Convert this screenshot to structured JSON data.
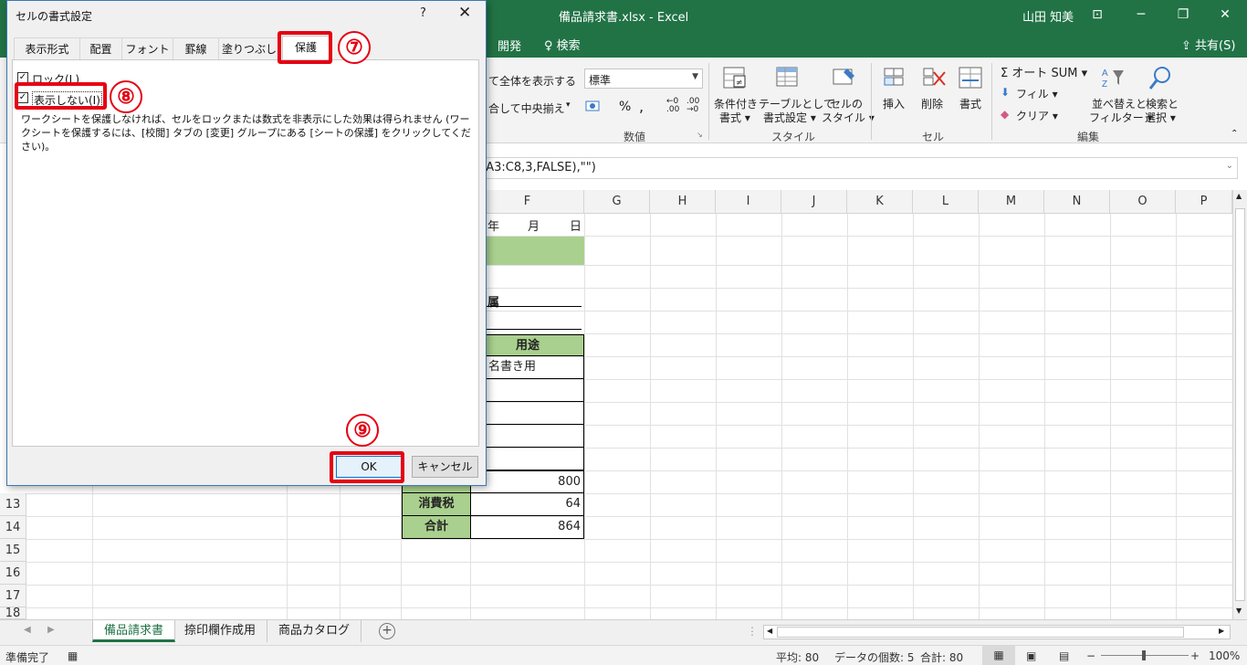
{
  "titlebar": {
    "doc_title": "備品請求書.xlsx  -  Excel",
    "user": "山田 知美",
    "minimize": "─",
    "restore": "❐",
    "close": "✕",
    "extra": "⊡"
  },
  "ribbon_tabs": {
    "develop": "開発",
    "tellme": "♀ 検索",
    "share": "⇪ 共有(S)"
  },
  "ribbon": {
    "fit_all": "て全体を表示する",
    "merge_center": "合して中央揃え",
    "number_format": "標準",
    "percent": "%",
    "comma": ",",
    "conditional_1": "条件付き",
    "conditional_2": "書式 ▾",
    "table_1": "テーブルとして",
    "table_2": "書式設定 ▾",
    "cellstyle_1": "セルの",
    "cellstyle_2": "スタイル ▾",
    "insert": "挿入",
    "delete": "削除",
    "format": "書式",
    "autosum": "Σ オート SUM  ▾",
    "fill": "フィル ▾",
    "clear": "クリア ▾",
    "sort_1": "並べ替えと",
    "sort_2": "フィルター ▾",
    "find_1": "検索と",
    "find_2": "選択 ▾",
    "group_number": "数値",
    "group_style": "スタイル",
    "group_cell": "セル",
    "group_edit": "編集"
  },
  "formula": {
    "text": "!A3:C8,3,FALSE),\"\")"
  },
  "grid": {
    "columns": [
      "F",
      "G",
      "H",
      "I",
      "J",
      "K",
      "L",
      "M",
      "N",
      "O",
      "P"
    ],
    "rows": [
      "13",
      "14",
      "15",
      "16",
      "17",
      "18"
    ],
    "cells": {
      "date_year": "年",
      "date_month": "月",
      "date_day": "日",
      "affiliation": "属",
      "usage_header": "用途",
      "usage_1": "名書き用",
      "subtotal_value": "800",
      "tax_label": "消費税",
      "tax_value": "64",
      "total_label": "合計",
      "total_value": "864"
    }
  },
  "sheets": {
    "tabs": [
      "備品請求書",
      "捺印欄作成用",
      "商品カタログ"
    ],
    "add": "+"
  },
  "status": {
    "ready": "準備完了",
    "average": "平均: 80",
    "count": "データの個数: 5",
    "sum": "合計: 80",
    "zoom": "100%"
  },
  "dialog": {
    "title": "セルの書式設定",
    "help": "?",
    "close": "✕",
    "tabs": [
      "表示形式",
      "配置",
      "フォント",
      "罫線",
      "塗りつぶし",
      "保護"
    ],
    "lock_label": "ロック(L)",
    "hidden_label": "表示しない(I)",
    "lock_checked": true,
    "hidden_checked": true,
    "note": "ワークシートを保護しなければ、セルをロックまたは数式を非表示にした効果は得られません (ワークシートを保護するには、[校閲] タブの [変更] グループにある [シートの保護] をクリックしてください)。",
    "ok": "OK",
    "cancel": "キャンセル"
  },
  "annotations": {
    "step7": "⑦",
    "step8": "⑧",
    "step9": "⑨",
    "color": "#e60012"
  },
  "colors": {
    "excel_green": "#217346",
    "table_green": "#a9d08e",
    "annotation_red": "#e60012"
  }
}
